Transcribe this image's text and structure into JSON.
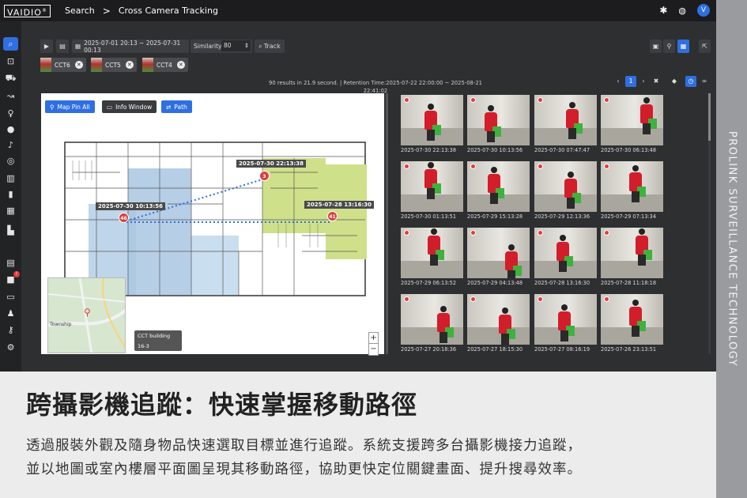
{
  "brand": {
    "logo": "VAIDIO",
    "logo_mark": "®",
    "side_label": "PROLINK SURVEILLANCE TECHNOLOGY"
  },
  "header": {
    "crumb_search": "Search",
    "separator": ">",
    "crumb_page": "Cross Camera Tracking",
    "avatar_letter": "V"
  },
  "toolbar": {
    "date_range": "2025-07-01 20:13 ~ 2025-07-31 00:13",
    "similarity_label": "Similarity",
    "similarity_value": "80",
    "track_label": "Track"
  },
  "cameras": [
    {
      "label": "CCT6"
    },
    {
      "label": "CCT5"
    },
    {
      "label": "CCT4"
    }
  ],
  "status": {
    "line1": "90 results in 21.9 second. | Retention Time:2025-07-22 22:00:00 ~ 2025-08-21",
    "line2": "22:41:02"
  },
  "map_buttons": {
    "map_pin_all": "Map Pin All",
    "info_window": "Info Window",
    "path": "Path"
  },
  "path_points": [
    {
      "label": "2025-07-30 10:13:56",
      "marker": "46"
    },
    {
      "label": "2025-07-30 22:13:38",
      "marker": "3"
    },
    {
      "label": "2025-07-28 13:16:30",
      "marker": "41"
    }
  ],
  "minimap": {
    "place": "Township"
  },
  "building": {
    "name": "CCT building",
    "sub": "16-3"
  },
  "zoom": {
    "plus": "+",
    "minus": "−"
  },
  "pager": {
    "current": "1"
  },
  "gallery": [
    "2025-07-30 22:13:38",
    "2025-07-30 10:13:56",
    "2025-07-30 07:47:47",
    "2025-07-30 06:13:48",
    "2025-07-30 01:13:51",
    "2025-07-29 15:13:28",
    "2025-07-29 12:13:36",
    "2025-07-29 07:13:34",
    "2025-07-29 06:13:52",
    "2025-07-29 04:13:48",
    "2025-07-28 13:16:30",
    "2025-07-28 11:18:18",
    "2025-07-27 20:18:36",
    "2025-07-27 18:15:30",
    "2025-07-27 08:16:19",
    "2025-07-26 23:13:51"
  ],
  "headline": "跨攝影機追蹤：快速掌握移動路徑",
  "description": [
    "透過服裝外觀及隨身物品快速選取目標並進行追蹤。系統支援跨多台攝影機接力追蹤，",
    "並以地圖或室內樓層平面圖呈現其移動路徑，協助更快定位關鍵畫面、提升搜尋效率。"
  ],
  "colors": {
    "accent": "#2f6fe0",
    "marker": "#d84040",
    "path": "#2f6fe0",
    "zone_green": "#cfe08a",
    "zone_blue": "#a9c7e2"
  }
}
